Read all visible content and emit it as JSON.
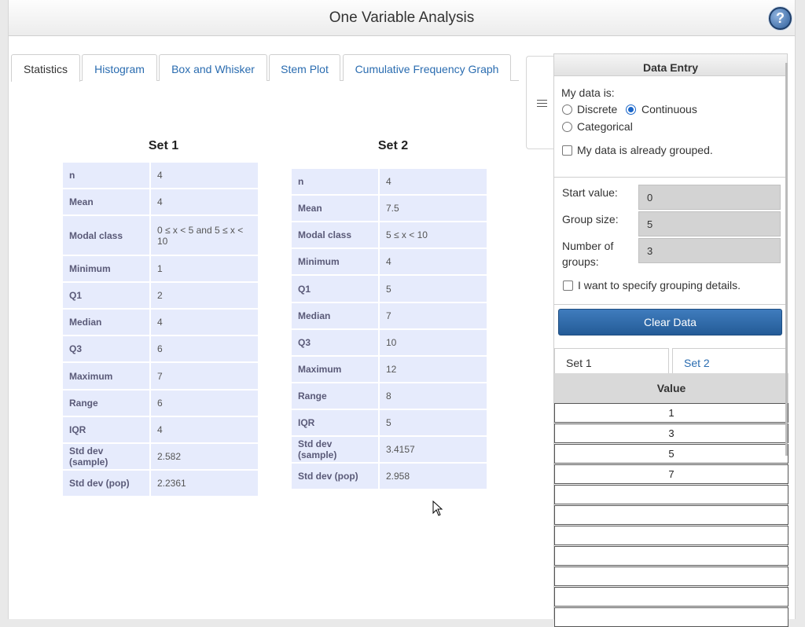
{
  "title": "One Variable Analysis",
  "help_label": "?",
  "tabs": [
    {
      "label": "Statistics"
    },
    {
      "label": "Histogram"
    },
    {
      "label": "Box and Whisker"
    },
    {
      "label": "Stem Plot"
    },
    {
      "label": "Cumulative Frequency Graph"
    }
  ],
  "set1": {
    "title": "Set 1",
    "rows": [
      {
        "label": "n",
        "value": "4"
      },
      {
        "label": "Mean",
        "value": "4"
      },
      {
        "label": "Modal class",
        "value": "0 ≤ x < 5 and 5 ≤ x < 10"
      },
      {
        "label": "Minimum",
        "value": "1"
      },
      {
        "label": "Q1",
        "value": "2"
      },
      {
        "label": "Median",
        "value": "4"
      },
      {
        "label": "Q3",
        "value": "6"
      },
      {
        "label": "Maximum",
        "value": "7"
      },
      {
        "label": "Range",
        "value": "6"
      },
      {
        "label": "IQR",
        "value": "4"
      },
      {
        "label": "Std dev (sample)",
        "value": "2.582"
      },
      {
        "label": "Std dev (pop)",
        "value": "2.2361"
      }
    ]
  },
  "set2": {
    "title": "Set 2",
    "rows": [
      {
        "label": "n",
        "value": "4"
      },
      {
        "label": "Mean",
        "value": "7.5"
      },
      {
        "label": "Modal class",
        "value": "5 ≤ x < 10"
      },
      {
        "label": "Minimum",
        "value": "4"
      },
      {
        "label": "Q1",
        "value": "5"
      },
      {
        "label": "Median",
        "value": "7"
      },
      {
        "label": "Q3",
        "value": "10"
      },
      {
        "label": "Maximum",
        "value": "12"
      },
      {
        "label": "Range",
        "value": "8"
      },
      {
        "label": "IQR",
        "value": "5"
      },
      {
        "label": "Std dev (sample)",
        "value": "3.4157"
      },
      {
        "label": "Std dev (pop)",
        "value": "2.958"
      }
    ]
  },
  "data_entry": {
    "header": "Data Entry",
    "my_data_is": "My data is:",
    "options": {
      "discrete": "Discrete",
      "continuous": "Continuous",
      "categorical": "Categorical"
    },
    "selected": "Continuous",
    "already_grouped": "My data is already grouped.",
    "start_value_label": "Start value:",
    "start_value": "0",
    "group_size_label": "Group size:",
    "group_size": "5",
    "num_groups_label_1": "Number of",
    "num_groups_label_2": "groups:",
    "num_groups": "3",
    "specify_grouping": "I want to specify grouping details.",
    "clear_button": "Clear Data",
    "set_tabs": [
      "Set 1",
      "Set 2"
    ],
    "value_header": "Value",
    "values": [
      "1",
      "3",
      "5",
      "7",
      "",
      "",
      "",
      "",
      "",
      "",
      ""
    ]
  },
  "colors": {
    "accent": "#2a6cb0",
    "stat_bg": "#e6ebfc",
    "button": "#2f6aa8"
  }
}
